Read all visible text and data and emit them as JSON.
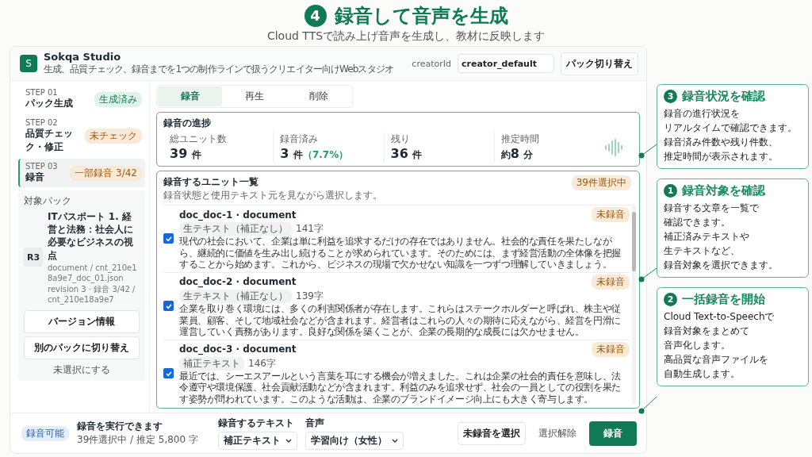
{
  "slide": {
    "step_number": "4",
    "title": "録音して音声を生成",
    "subtitle": "Cloud TTSで読み上げ音声を生成し、教材に反映します"
  },
  "app": {
    "logo": "S",
    "name": "Sokqa Studio",
    "tagline": "生成、品質チェック、録音までを1つの制作ラインで扱うクリエイター向けWebスタジオ",
    "creator_label": "creatorId",
    "creator_value": "creator_default",
    "switch_button": "パック切り替え"
  },
  "steps": [
    {
      "step": "STEP 01",
      "label": "パック生成",
      "badge": "生成済み",
      "kind": "done",
      "selected": false
    },
    {
      "step": "STEP 02",
      "label": "品質チェック・修正",
      "badge": "未チェック",
      "kind": "warn",
      "selected": false
    },
    {
      "step": "STEP 03",
      "label": "録音",
      "badge": "一部録音 3/42",
      "kind": "warn",
      "selected": true
    }
  ],
  "target_pack": {
    "heading": "対象パック",
    "badge": "R3",
    "title": "ITパスポート 1. 経営と法務：社会人に必要なビジネスの視点",
    "meta": [
      "document / cnt_210e18a9e7_doc_01.json",
      "revision 3 · 録音 3/42 / cnt_210e18a9e7"
    ],
    "buttons": [
      "バージョン情報",
      "別のパックに切り替え"
    ],
    "link": "未選択にする"
  },
  "tabs": [
    {
      "label": "録音",
      "selected": true
    },
    {
      "label": "再生",
      "selected": false
    },
    {
      "label": "削除",
      "selected": false
    }
  ],
  "progress": {
    "title": "録音の進捗",
    "stats": [
      {
        "label": "総ユニット数",
        "value": "39",
        "unit": "件"
      },
      {
        "label": "録音済み",
        "value": "3",
        "unit": "件",
        "note": "（7.7%）"
      },
      {
        "label": "残り",
        "value": "36",
        "unit": "件"
      },
      {
        "label": "推定時間",
        "prefix": "約",
        "value": "8",
        "unit": "分"
      }
    ]
  },
  "unit_list": {
    "title": "録音するユニット一覧",
    "description": "録音状態と使用テキスト元を見ながら選択します。",
    "badge": "39件選択中",
    "units": [
      {
        "title": "doc_doc-1 · document",
        "source": "生テキスト（補正なし）",
        "chars": "141字",
        "status": "未録音",
        "checked": true,
        "text": "現代の社会において、企業は単に利益を追求するだけの存在ではありません。社会的な責任を果たしながら、継続的に価値を生み出し続けることが求められています。そのためには、まず経営活動の全体像を把握することから始めます。これから、ビジネスの現場で欠かせない知識を一つずつ理解していきましょう。"
      },
      {
        "title": "doc_doc-2 · document",
        "source": "生テキスト（補正なし）",
        "chars": "139字",
        "status": "未録音",
        "checked": true,
        "text": "企業を取り巻く環境には、多くの利害関係者が存在します。これらはステークホルダーと呼ばれ、株主や従業員、顧客、そして地域社会などが含まれます。経営者はこれらの人々の期待に応えながら、経営を円滑に運営していく責務があります。良好な関係を築くことが、企業の長期的な成長には欠かせません。"
      },
      {
        "title": "doc_doc-3 · document",
        "source": "補正テキスト",
        "chars": "146字",
        "status": "未録音",
        "checked": true,
        "text": "最近では、シーエスアールという言葉を耳にする機会が増えました。これは企業の社会的責任を意味し、法令遵守や環境保護、社会貢献活動などが含まれます。利益のみを追求せず、社会の一員としての役割を果たす姿勢が問われています。このような活動は、企業のブランドイメージ向上にも大きく寄与します。"
      }
    ]
  },
  "bottom_bar": {
    "badge": "録音可能",
    "title": "録音を実行できます",
    "summary": "39件選択中 / 推定 5,800 字",
    "text_label": "録音するテキスト",
    "text_value": "補正テキスト",
    "voice_label": "音声",
    "voice_value": "学習向け（女性）",
    "select_button": "未録音を選択",
    "clear_button": "選択解除",
    "record_button": "録音"
  },
  "callouts": [
    {
      "number": "3",
      "title": "録音状況を確認",
      "lines": [
        "録音の進行状況を",
        "リアルタイムで確認できます。",
        "録音済み件数や残り件数、",
        "推定時間が表示されます。"
      ]
    },
    {
      "number": "1",
      "title": "録音対象を確認",
      "lines": [
        "録音する文章を一覧で",
        "確認できます。",
        "補正済みテキストや",
        "生テキストなど、",
        "録音対象を選択できます。"
      ]
    },
    {
      "number": "2",
      "title": "一括録音を開始",
      "lines": [
        "Cloud Text-to-Speechで",
        "録音対象をまとめて",
        "音声化します。",
        "高品質な音声ファイルを",
        "自動生成します。"
      ]
    }
  ]
}
